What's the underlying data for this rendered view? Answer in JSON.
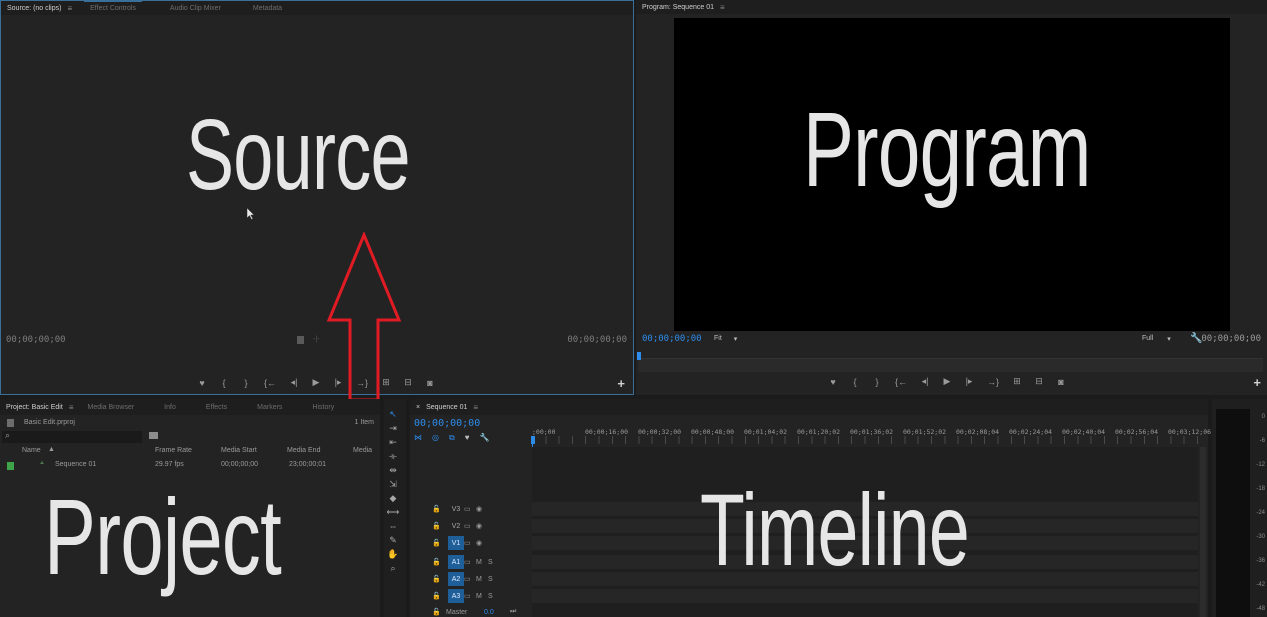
{
  "source_panel": {
    "tabs": [
      {
        "label": "Source: (no clips)",
        "active": true
      },
      {
        "label": "Effect Controls",
        "active": false
      },
      {
        "label": "Audio Clip Mixer",
        "active": false
      },
      {
        "label": "Metadata",
        "active": false
      }
    ],
    "overlay_label": "Source",
    "timecode_left": "00;00;00;00",
    "timecode_right": "00;00;00;00"
  },
  "program_panel": {
    "tab_label": "Program: Sequence 01",
    "overlay_label": "Program",
    "timecode_left": "00;00;00;00",
    "fit_label": "Fit",
    "resolution_label": "Full",
    "timecode_right": "00;00;00;00"
  },
  "project_panel": {
    "tabs": [
      {
        "label": "Project: Basic Edit",
        "active": true
      },
      {
        "label": "Media Browser",
        "active": false
      },
      {
        "label": "Info",
        "active": false
      },
      {
        "label": "Effects",
        "active": false
      },
      {
        "label": "Markers",
        "active": false
      },
      {
        "label": "History",
        "active": false
      }
    ],
    "file_name": "Basic Edit.prproj",
    "item_count": "1 Item",
    "columns": [
      "Name",
      "Frame Rate",
      "Media Start",
      "Media End",
      "Media"
    ],
    "rows": [
      {
        "name": "Sequence 01",
        "frame_rate": "29.97 fps",
        "media_start": "00;00;00;00",
        "media_end": "23;00;00;01"
      }
    ],
    "overlay_label": "Project"
  },
  "timeline_panel": {
    "tab_label": "Sequence 01",
    "timecode": "00;00;00;00",
    "ruler_labels": [
      ";00;00",
      "00;00;16;00",
      "00;00;32;00",
      "00;00;48;00",
      "00;01;04;02",
      "00;01;20;02",
      "00;01;36;02",
      "00;01;52;02",
      "00;02;08;04",
      "00;02;24;04",
      "00;02;40;04",
      "00;02;56;04",
      "00;03;12;06"
    ],
    "video_tracks": [
      "V3",
      "V2",
      "V1"
    ],
    "audio_tracks": [
      "A1",
      "A2",
      "A3"
    ],
    "mute_label": "M",
    "solo_label": "S",
    "master_label": "Master",
    "master_value": "0.0",
    "overlay_label": "Timeline"
  },
  "audio_meter": {
    "labels": [
      "0",
      "-6",
      "-12",
      "-18",
      "-24",
      "-30",
      "-36",
      "-42",
      "-48"
    ]
  },
  "colors": {
    "accent_blue": "#2d8ceb",
    "arrow_red": "#e01b24",
    "panel_bg": "#232323",
    "video_bg": "#000000"
  }
}
